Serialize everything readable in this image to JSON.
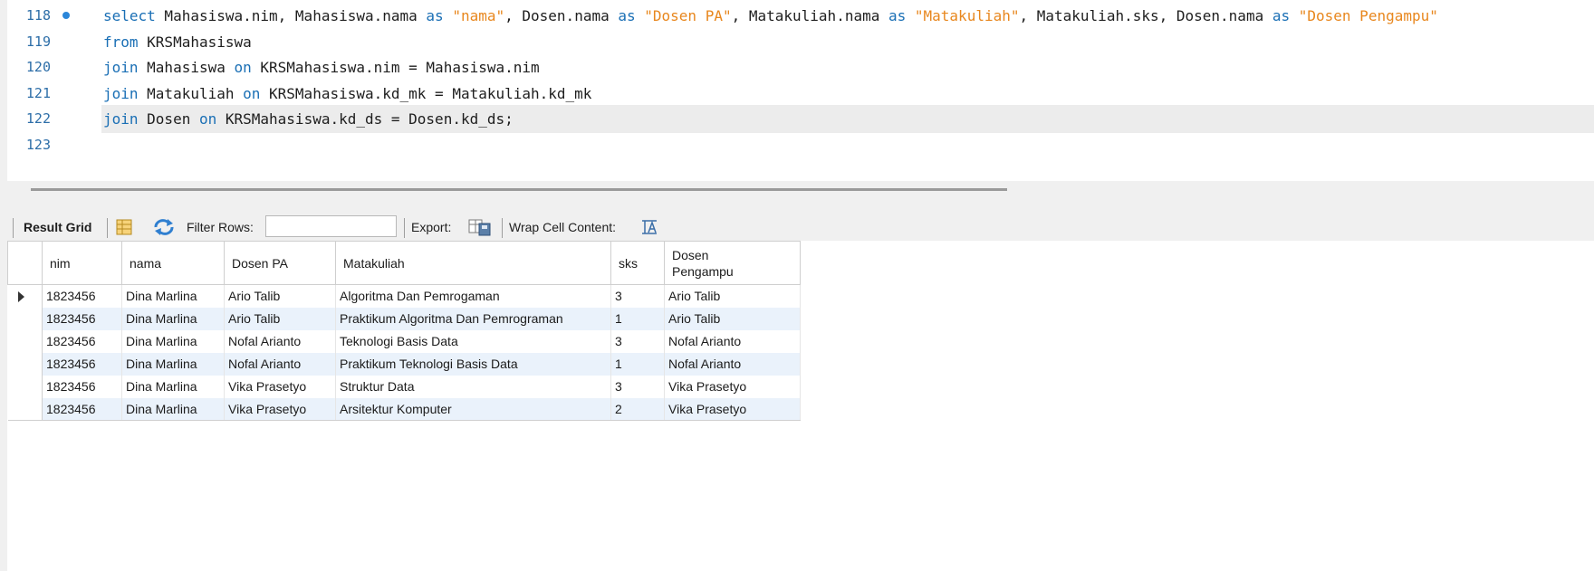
{
  "editor": {
    "lines": [
      {
        "num": "118",
        "tokens": [
          {
            "t": "select",
            "k": "kw"
          },
          {
            "t": " Mahasiswa.nim, Mahasiswa.nama ",
            "k": ""
          },
          {
            "t": "as",
            "k": "kw"
          },
          {
            "t": " ",
            "k": ""
          },
          {
            "t": "\"nama\"",
            "k": "str"
          },
          {
            "t": ", Dosen.nama ",
            "k": ""
          },
          {
            "t": "as",
            "k": "kw"
          },
          {
            "t": " ",
            "k": ""
          },
          {
            "t": "\"Dosen PA\"",
            "k": "str"
          },
          {
            "t": ", Matakuliah.nama ",
            "k": ""
          },
          {
            "t": "as",
            "k": "kw"
          },
          {
            "t": " ",
            "k": ""
          },
          {
            "t": "\"Matakuliah\"",
            "k": "str"
          },
          {
            "t": ", Matakuliah.sks, Dosen.nama ",
            "k": ""
          },
          {
            "t": "as",
            "k": "kw"
          },
          {
            "t": " ",
            "k": ""
          },
          {
            "t": "\"Dosen Pengampu\"",
            "k": "str"
          }
        ]
      },
      {
        "num": "119",
        "tokens": [
          {
            "t": "from",
            "k": "kw"
          },
          {
            "t": " KRSMahasiswa",
            "k": ""
          }
        ]
      },
      {
        "num": "120",
        "tokens": [
          {
            "t": "join",
            "k": "kw"
          },
          {
            "t": " Mahasiswa ",
            "k": ""
          },
          {
            "t": "on",
            "k": "kw"
          },
          {
            "t": " KRSMahasiswa.nim = Mahasiswa.nim",
            "k": ""
          }
        ]
      },
      {
        "num": "121",
        "tokens": [
          {
            "t": "join",
            "k": "kw"
          },
          {
            "t": " Matakuliah ",
            "k": ""
          },
          {
            "t": "on",
            "k": "kw"
          },
          {
            "t": " KRSMahasiswa.kd_mk = Matakuliah.kd_mk",
            "k": ""
          }
        ]
      },
      {
        "num": "122",
        "tokens": [
          {
            "t": "join",
            "k": "kw"
          },
          {
            "t": " Dosen ",
            "k": ""
          },
          {
            "t": "on",
            "k": "kw"
          },
          {
            "t": " KRSMahasiswa.kd_ds = Dosen.kd_ds;",
            "k": ""
          }
        ]
      },
      {
        "num": "123",
        "tokens": []
      }
    ]
  },
  "toolbar": {
    "result_grid": "Result Grid",
    "filter_rows": "Filter Rows:",
    "filter_value": "",
    "export": "Export:",
    "wrap": "Wrap Cell Content:",
    "icons": [
      "grid-view-icon",
      "refresh-icon",
      "export-file-icon",
      "wrap-text-icon"
    ]
  },
  "grid": {
    "columns": [
      "nim",
      "nama",
      "Dosen PA",
      "Matakuliah",
      "sks",
      "Dosen Pengampu"
    ],
    "rows": [
      [
        "1823456",
        "Dina Marlina",
        "Ario Talib",
        "Algoritma Dan Pemrogaman",
        "3",
        "Ario Talib"
      ],
      [
        "1823456",
        "Dina Marlina",
        "Ario Talib",
        "Praktikum Algoritma Dan Pemrograman",
        "1",
        "Ario Talib"
      ],
      [
        "1823456",
        "Dina Marlina",
        "Nofal Arianto",
        "Teknologi Basis Data",
        "3",
        "Nofal Arianto"
      ],
      [
        "1823456",
        "Dina Marlina",
        "Nofal Arianto",
        "Praktikum Teknologi Basis Data",
        "1",
        "Nofal Arianto"
      ],
      [
        "1823456",
        "Dina Marlina",
        "Vika Prasetyo",
        "Struktur Data",
        "3",
        "Vika Prasetyo"
      ],
      [
        "1823456",
        "Dina Marlina",
        "Vika Prasetyo",
        "Arsitektur Komputer",
        "2",
        "Vika Prasetyo"
      ]
    ]
  },
  "colors": {
    "keyword": "#1a6fb5",
    "string": "#e8871e",
    "line_number": "#2d6ea8",
    "alt_row": "#eaf2fb"
  }
}
